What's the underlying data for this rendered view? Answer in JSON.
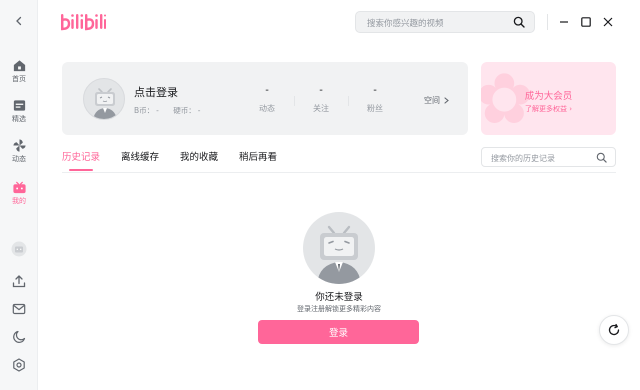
{
  "app": {
    "brand": "bilibili"
  },
  "colors": {
    "accent": "#ff6699",
    "rail_bg": "#f6f7f8",
    "card_bg": "#f1f2f3",
    "vip_bg": "#ffe5ee"
  },
  "header": {
    "search_placeholder": "搜索你感兴趣的视频"
  },
  "sidebar": {
    "items": [
      {
        "label": "首页",
        "icon": "home-icon"
      },
      {
        "label": "精选",
        "icon": "featured-icon"
      },
      {
        "label": "动态",
        "icon": "dynamic-icon"
      },
      {
        "label": "我的",
        "icon": "my-tv-icon"
      }
    ],
    "bottom_icons": [
      "avatar-icon",
      "upload-icon",
      "mail-icon",
      "theme-moon-icon",
      "settings-icon"
    ]
  },
  "profile": {
    "login_title": "点击登录",
    "b_coin_label": "B币：",
    "b_coin_value": "-",
    "coin_label": "硬币：",
    "coin_value": "-",
    "stats": [
      {
        "value": "-",
        "label": "动态"
      },
      {
        "value": "-",
        "label": "关注"
      },
      {
        "value": "-",
        "label": "粉丝"
      }
    ],
    "space_link": "空间"
  },
  "vip": {
    "title": "成为大会员",
    "subtitle": "了解更多权益 ›"
  },
  "tabs": [
    "历史记录",
    "离线缓存",
    "我的收藏",
    "稍后再看"
  ],
  "history_search": {
    "placeholder": "搜索你的历史记录"
  },
  "empty_state": {
    "title": "你还未登录",
    "subtitle": "登录注册解锁更多精彩内容",
    "button": "登录"
  }
}
